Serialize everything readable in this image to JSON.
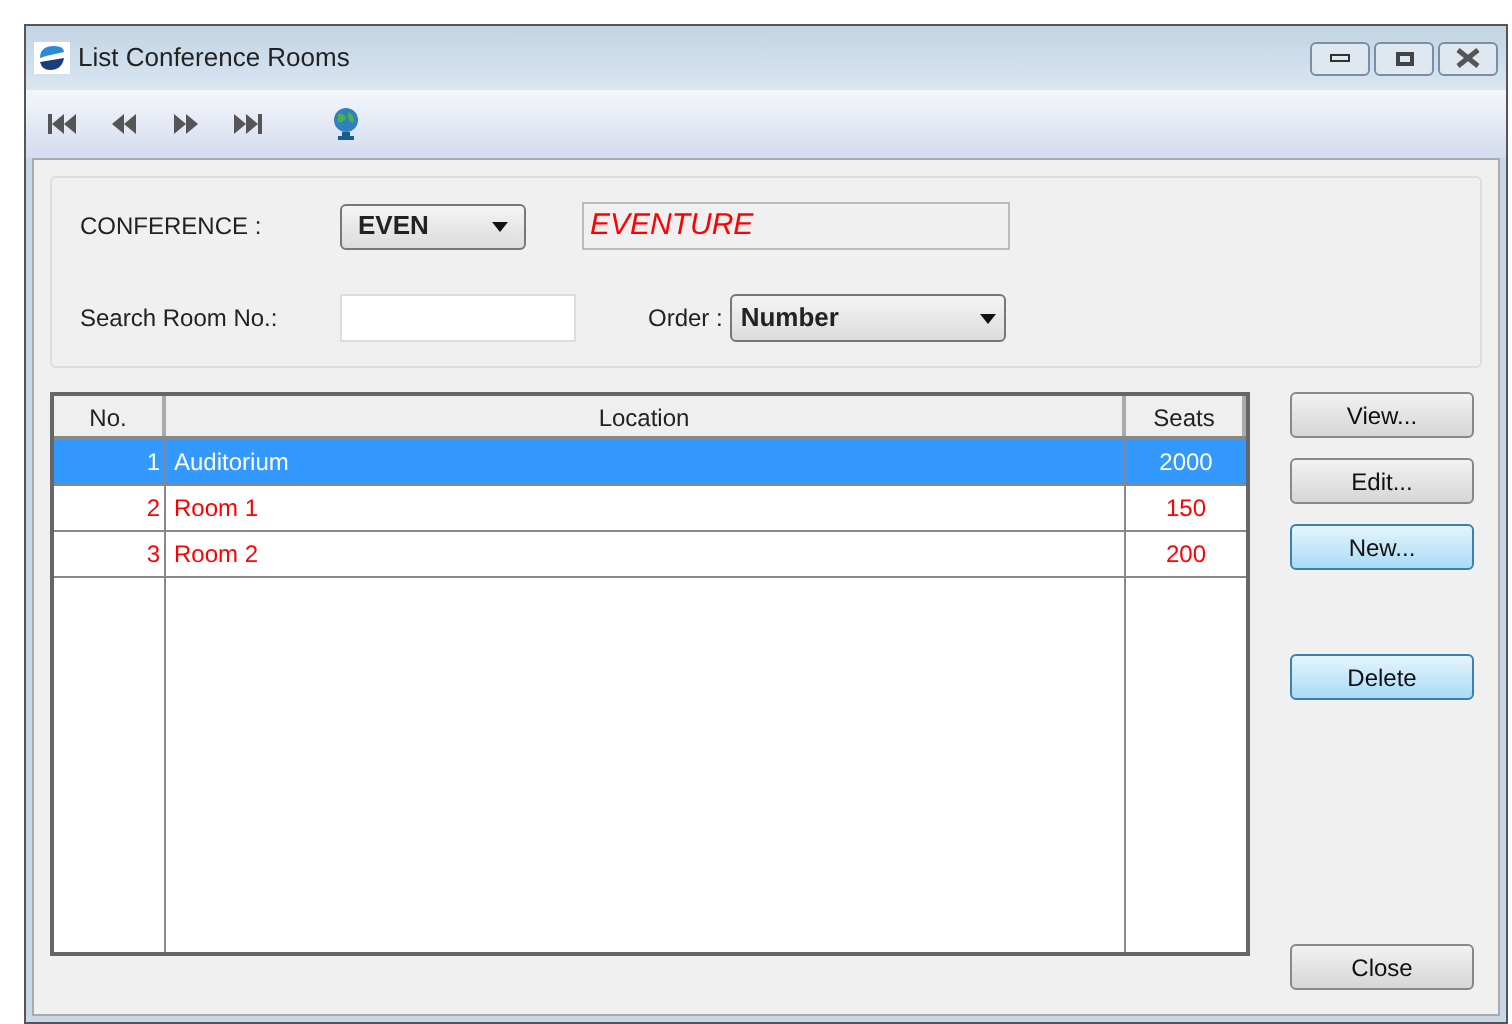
{
  "window": {
    "title": "List Conference Rooms"
  },
  "toolbar": [
    {
      "kind": "first"
    },
    {
      "kind": "prev"
    },
    {
      "kind": "next"
    },
    {
      "kind": "last"
    },
    {
      "kind": "globe"
    }
  ],
  "filters": {
    "conference_label": "CONFERENCE :",
    "conference_value": "EVEN",
    "conference_name": "EVENTURE",
    "search_label": "Search Room No.:",
    "order_label": "Order :",
    "order_value": "Number"
  },
  "table": {
    "columns": [
      "No.",
      "Location",
      "Seats"
    ],
    "rows": [
      {
        "cells": [
          "1",
          "Auditorium",
          "2000"
        ],
        "selected": true
      },
      {
        "cells": [
          "2",
          "Room 1",
          "150"
        ],
        "selected": false
      },
      {
        "cells": [
          "3",
          "Room 2",
          "200"
        ],
        "selected": false
      }
    ]
  },
  "buttons": [
    {
      "label": "View...",
      "highlighted": false
    },
    {
      "label": "Edit...",
      "highlighted": false
    },
    {
      "label": "New...",
      "highlighted": true
    },
    {
      "label": "Delete",
      "highlighted": true
    },
    {
      "label": "Close",
      "highlighted": false
    }
  ]
}
